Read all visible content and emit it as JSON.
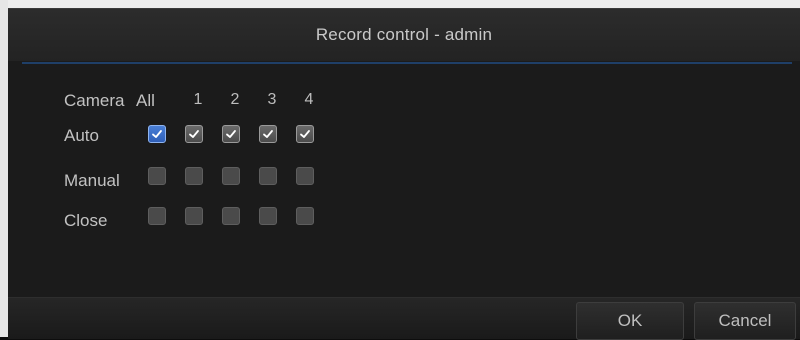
{
  "window": {
    "title": "Record control - admin"
  },
  "grid": {
    "camera_label": "Camera",
    "all_label": "All",
    "channels": [
      "1",
      "2",
      "3",
      "4"
    ],
    "rows": [
      {
        "label": "Auto",
        "checked": [
          true,
          true,
          true,
          true,
          true
        ]
      },
      {
        "label": "Manual",
        "checked": [
          false,
          false,
          false,
          false,
          false
        ]
      },
      {
        "label": "Close",
        "checked": [
          false,
          false,
          false,
          false,
          false
        ]
      }
    ]
  },
  "buttons": {
    "ok": "OK",
    "cancel": "Cancel"
  },
  "colors": {
    "accent_line": "#1f3f68",
    "focus_checkbox": "#3b6fc9"
  }
}
